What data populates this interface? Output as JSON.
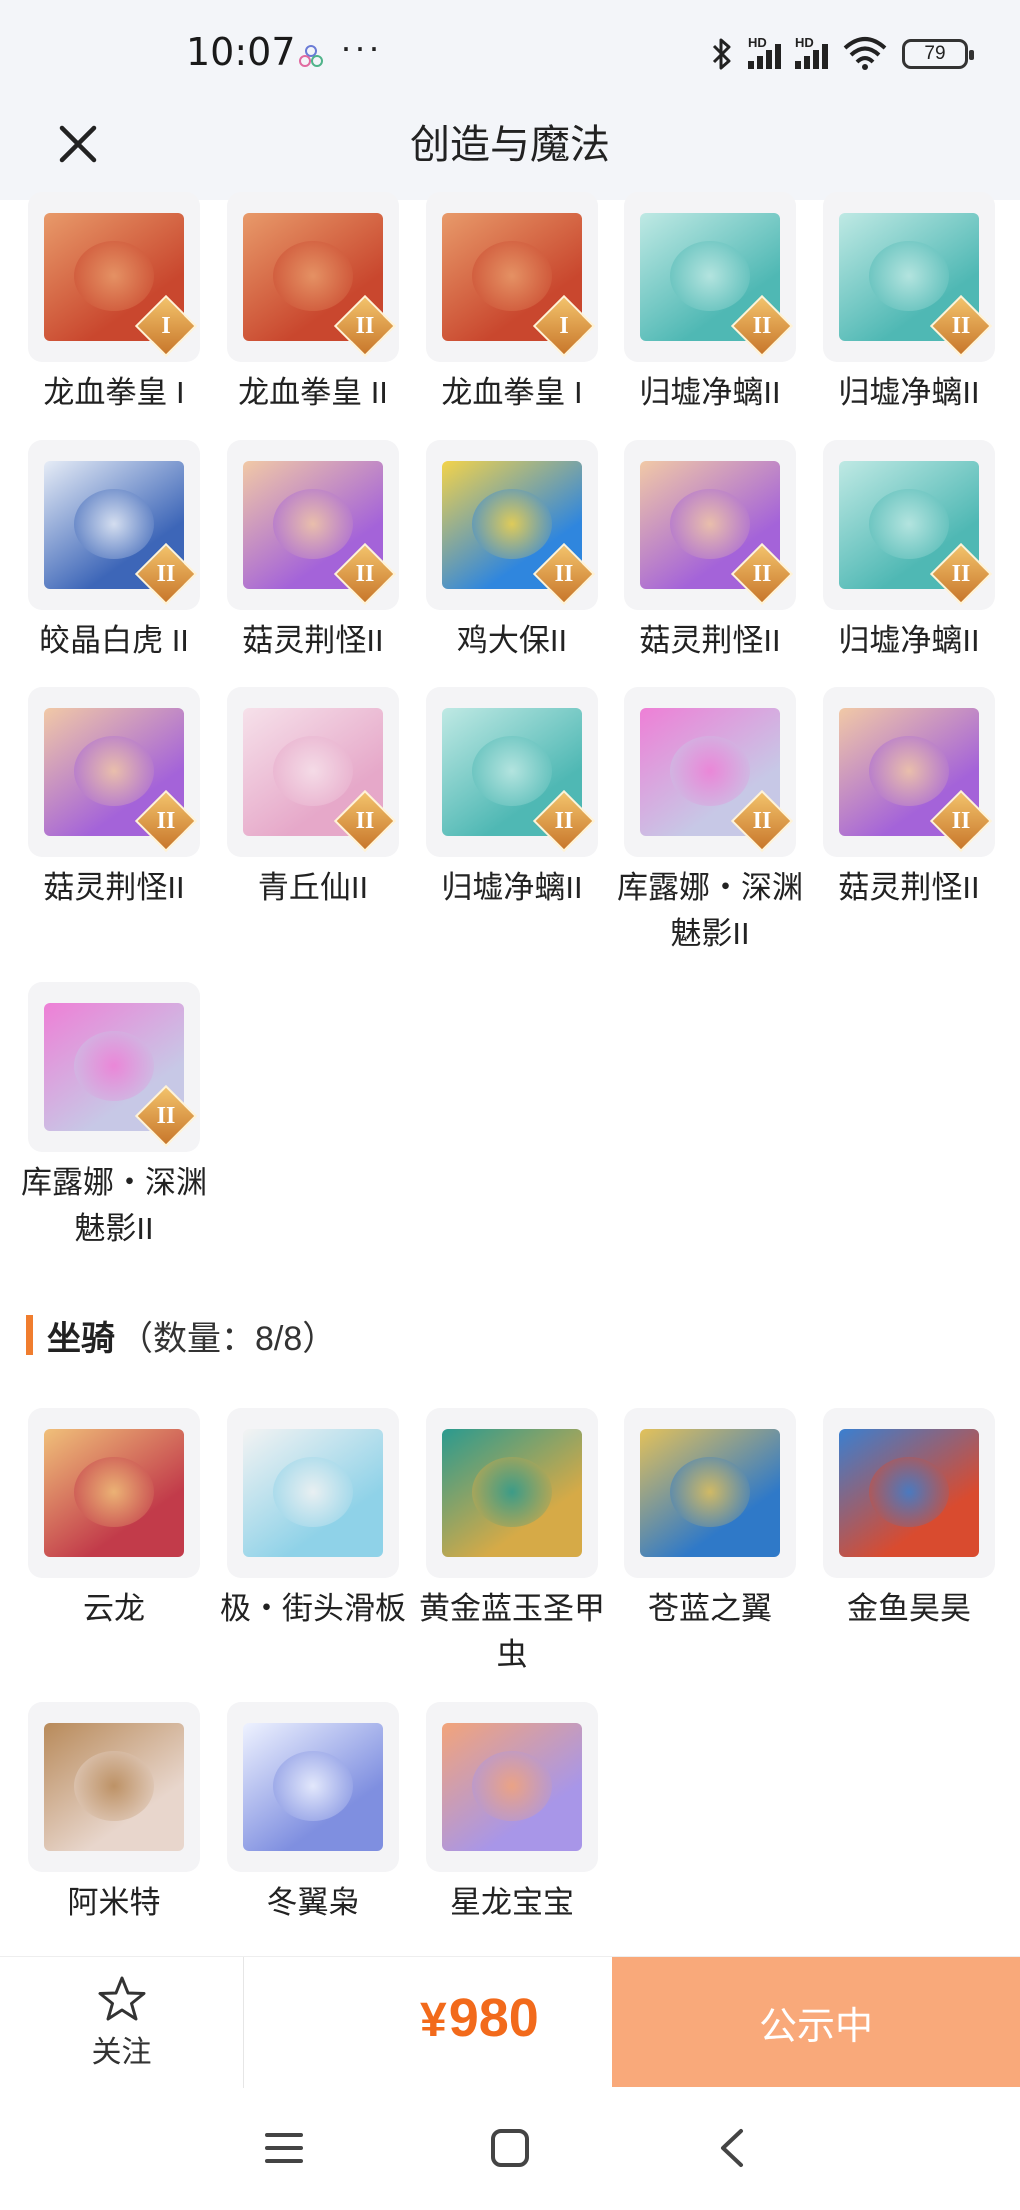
{
  "status_bar": {
    "time": "10:07",
    "dots": "···",
    "signal_label": "HD",
    "wifi_label": "6",
    "battery": "79"
  },
  "header": {
    "title": "创造与魔法"
  },
  "pets": [
    {
      "label": "龙血拳皇 I",
      "grade": "I",
      "color": "#c9472e",
      "accent": "#e89a6a"
    },
    {
      "label": "龙血拳皇 II",
      "grade": "II",
      "color": "#c9472e",
      "accent": "#e89a6a"
    },
    {
      "label": "龙血拳皇 I",
      "grade": "I",
      "color": "#c9472e",
      "accent": "#e89a6a"
    },
    {
      "label": "归墟净螭II",
      "grade": "II",
      "color": "#4fb8b4",
      "accent": "#bfe9e4"
    },
    {
      "label": "归墟净螭II",
      "grade": "II",
      "color": "#4fb8b4",
      "accent": "#bfe9e4"
    },
    {
      "label": "皎晶白虎 II",
      "grade": "II",
      "color": "#3d66b8",
      "accent": "#e6ecf6"
    },
    {
      "label": "菇灵荆怪II",
      "grade": "II",
      "color": "#a463d9",
      "accent": "#f1c9a6"
    },
    {
      "label": "鸡大保II",
      "grade": "II",
      "color": "#2f86de",
      "accent": "#f3d34a"
    },
    {
      "label": "菇灵荆怪II",
      "grade": "II",
      "color": "#a463d9",
      "accent": "#f1c9a6"
    },
    {
      "label": "归墟净螭II",
      "grade": "II",
      "color": "#4fb8b4",
      "accent": "#bfe9e4"
    },
    {
      "label": "菇灵荆怪II",
      "grade": "II",
      "color": "#a463d9",
      "accent": "#f1c9a6"
    },
    {
      "label": "青丘仙II",
      "grade": "II",
      "color": "#e6a8c9",
      "accent": "#f6e1ea"
    },
    {
      "label": "归墟净螭II",
      "grade": "II",
      "color": "#4fb8b4",
      "accent": "#bfe9e4"
    },
    {
      "label": "库露娜・深渊魅影II",
      "grade": "II",
      "color": "#c7c8e6",
      "accent": "#ee7fd6"
    },
    {
      "label": "菇灵荆怪II",
      "grade": "II",
      "color": "#a463d9",
      "accent": "#f1c9a6"
    },
    {
      "label": "库露娜・深渊魅影II",
      "grade": "II",
      "color": "#c7c8e6",
      "accent": "#ee7fd6"
    }
  ],
  "mounts_section": {
    "name": "坐骑",
    "count_text": "（数量：8/8）"
  },
  "mounts": [
    {
      "label": "云龙",
      "color": "#c23b4a",
      "accent": "#f0c07a"
    },
    {
      "label": "极・街头滑板",
      "color": "#8fd2e8",
      "accent": "#f3f3f3"
    },
    {
      "label": "黄金蓝玉圣甲虫",
      "color": "#d6aa47",
      "accent": "#2a9a8f"
    },
    {
      "label": "苍蓝之翼",
      "color": "#2f79c8",
      "accent": "#e3c15a"
    },
    {
      "label": "金鱼昊昊",
      "color": "#d94b2f",
      "accent": "#3a7fd0"
    },
    {
      "label": "阿米特",
      "color": "#e8d6cc",
      "accent": "#b88a5a"
    },
    {
      "label": "冬翼枭",
      "color": "#7f8fe0",
      "accent": "#eef2ff"
    },
    {
      "label": "星龙宝宝",
      "color": "#a896e8",
      "accent": "#f2a47a"
    }
  ],
  "bottom_bar": {
    "follow_label": "关注",
    "price_symbol": "¥",
    "price": "980",
    "status_button": "公示中"
  },
  "colors": {
    "accent": "#f07d2e",
    "price": "#f26a1b",
    "status_button": "#f9a97a",
    "header_bg": "#f3f5f9"
  },
  "icons": {
    "close": "close-icon",
    "follow": "star-icon",
    "nav_menu": "menu-icon",
    "nav_home": "home-icon",
    "nav_back": "back-icon"
  }
}
